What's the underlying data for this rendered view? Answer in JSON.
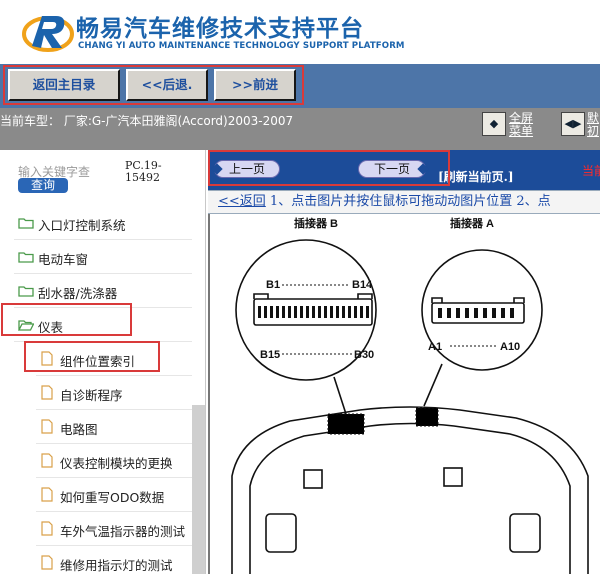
{
  "header": {
    "title": "畅易汽车维修技术支持平台",
    "subtitle": "CHANG YI AUTO MAINTENANCE TECHNOLOGY SUPPORT PLATFORM"
  },
  "nav": {
    "back_main": "返回主目录",
    "back": "<<后退.",
    "forward": ">>前进"
  },
  "info": {
    "vehicle": "当前车型： 厂家:G-广汽本田雅阁(Accord)2003-2007",
    "fullscreen_line1": "全屏",
    "fullscreen_line2": "菜单",
    "other_line1": "默",
    "other_line2": "初"
  },
  "sidebar": {
    "keyword_placeholder": "输入关键字查",
    "query_label": "查询",
    "pc_code": "PC.19-15492",
    "items": [
      {
        "label": "入口灯控制系统",
        "type": "folder"
      },
      {
        "label": "电动车窗",
        "type": "folder"
      },
      {
        "label": "刮水器/洗涤器",
        "type": "folder"
      },
      {
        "label": "仪表",
        "type": "folder-open"
      },
      {
        "label": "组件位置索引",
        "type": "page"
      },
      {
        "label": "自诊断程序",
        "type": "page"
      },
      {
        "label": "电路图",
        "type": "page"
      },
      {
        "label": "仪表控制模块的更换",
        "type": "page"
      },
      {
        "label": "如何重写ODO数据",
        "type": "page"
      },
      {
        "label": "车外气温指示器的测试",
        "type": "page"
      },
      {
        "label": "维修用指示灯的测试",
        "type": "page"
      }
    ]
  },
  "toolbar": {
    "prev_page": "上一页",
    "next_page": "下一页",
    "refresh": "[刷新当前页.]",
    "current": "当前"
  },
  "hint": {
    "back_link": "<<返回",
    "text": " 1、点击图片并按住鼠标可拖动动图片位置 2、点"
  },
  "diagram": {
    "connector_b": "插接器 B",
    "connector_a": "插接器 A",
    "b1": "B1",
    "b14": "B14",
    "b15": "B15",
    "b30": "B30",
    "a1": "A1",
    "a10": "A10"
  },
  "colors": {
    "brand_blue": "#1b63ac",
    "nav_bar": "#4d75a8",
    "toolbar": "#1c4c99",
    "highlight_red": "#d93a3a"
  }
}
